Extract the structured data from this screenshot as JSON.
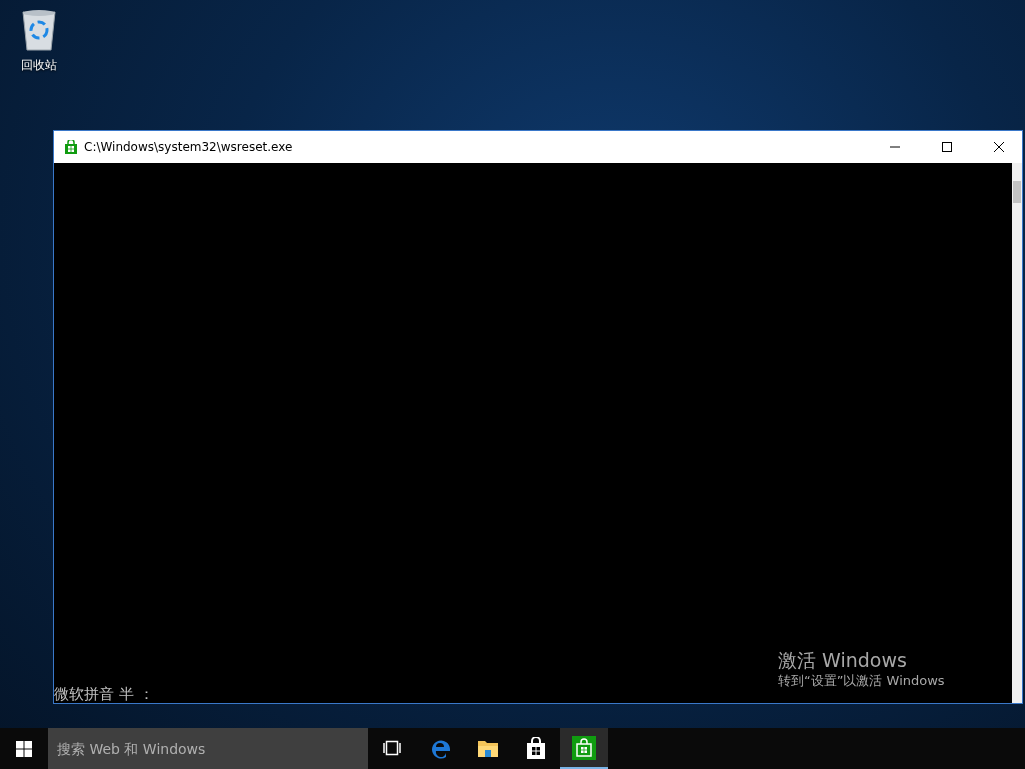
{
  "desktop_icons": [
    {
      "label": "回收站"
    }
  ],
  "window": {
    "title": "C:\\Windows\\system32\\wsreset.exe",
    "console_text": "微软拼音 半 ："
  },
  "activation_notice": {
    "title": "激活 Windows",
    "subtitle": "转到“设置”以激活 Windows"
  },
  "taskbar": {
    "search": {
      "placeholder": "搜索 Web 和 Windows"
    },
    "apps": [
      {
        "kind": "task-view",
        "active": false
      },
      {
        "kind": "edge",
        "active": false
      },
      {
        "kind": "explorer",
        "active": false
      },
      {
        "kind": "store",
        "active": false
      },
      {
        "kind": "store-app",
        "active": true
      }
    ]
  }
}
